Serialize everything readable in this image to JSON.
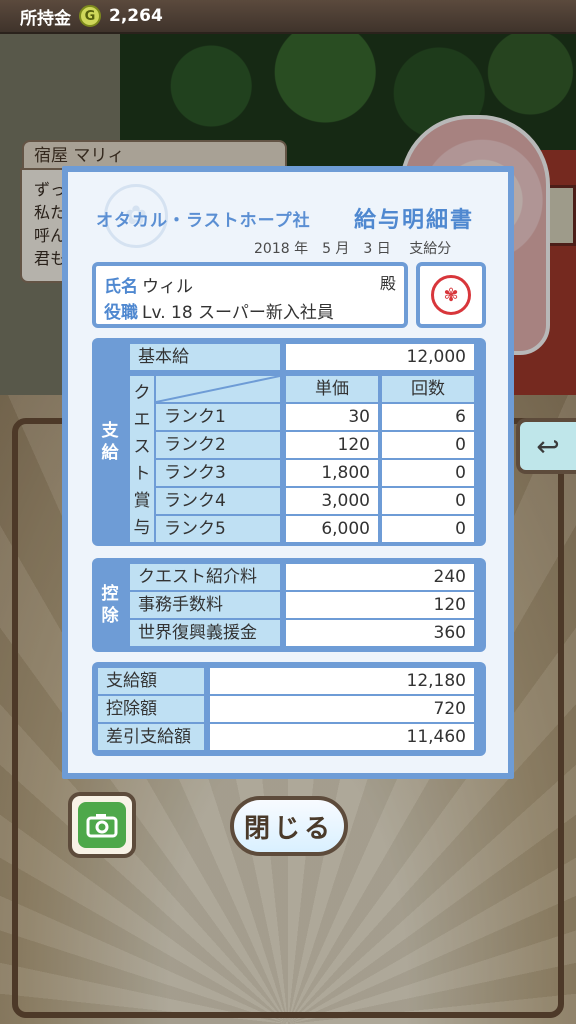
{
  "topbar": {
    "label": "所持金",
    "coin_symbol": "G",
    "amount": "2,264"
  },
  "speaker": {
    "name": "宿屋 マリィ"
  },
  "dialog": {
    "lines": [
      "ずっ",
      "私た",
      "呼ん",
      "君も"
    ]
  },
  "slip": {
    "company": "オタカル・ラストホープ社",
    "title": "給与明細書",
    "date": "2018 年　5 月　3 日　 支給分",
    "name_label": "氏名",
    "name_value": "ウィル",
    "honorific": "殿",
    "position_label": "役職",
    "position_value": "Lv. 18 スーパー新入社員",
    "stamp_icon": "seal-stamp",
    "payment": {
      "section_label": [
        "支",
        "給"
      ],
      "base_label": "基本給",
      "base_value": "12,000",
      "quest_label": [
        "ク",
        "エ",
        "ス",
        "ト",
        "賞",
        "与"
      ],
      "col_unit": "単価",
      "col_count": "回数",
      "ranks": [
        {
          "label": "ランク1",
          "unit": "30",
          "count": "6"
        },
        {
          "label": "ランク2",
          "unit": "120",
          "count": "0"
        },
        {
          "label": "ランク3",
          "unit": "1,800",
          "count": "0"
        },
        {
          "label": "ランク4",
          "unit": "3,000",
          "count": "0"
        },
        {
          "label": "ランク5",
          "unit": "6,000",
          "count": "0"
        }
      ]
    },
    "deduction": {
      "section_label": [
        "控",
        "除"
      ],
      "items": [
        {
          "label": "クエスト紹介料",
          "value": "240"
        },
        {
          "label": "事務手数料",
          "value": "120"
        },
        {
          "label": "世界復興義援金",
          "value": "360"
        }
      ]
    },
    "totals": [
      {
        "label": "支給額",
        "value": "12,180"
      },
      {
        "label": "控除額",
        "value": "720"
      },
      {
        "label": "差引支給額",
        "value": "11,460"
      }
    ]
  },
  "buttons": {
    "close": "閉じる",
    "camera_icon": "camera-icon",
    "back_icon": "back-arrow-icon"
  }
}
